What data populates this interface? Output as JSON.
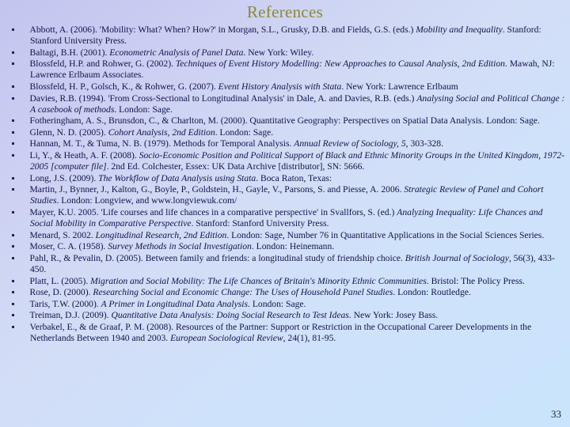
{
  "slide": {
    "title": "References",
    "title_color": "#8a8a2f",
    "text_color": "#12124a",
    "background_start": "#c3c4ef",
    "background_end": "#c9e4fc",
    "page_number": "33"
  },
  "references": [
    {
      "id": "abbott-2006",
      "html": "Abbott, A. (2006). 'Mobility: What? When? How?' in Morgan, S.L., Grusky, D.B. and Fields, G.S. (eds.) <i>Mobility and Inequality</i>. Stanford:  Stanford University Press.",
      "plain": "Abbott, A. (2006). 'Mobility: What? When? How?' in Morgan, S.L., Grusky, D.B. and Fields, G.S. (eds.) Mobility and Inequality. Stanford: Stanford University Press."
    },
    {
      "id": "baltagi-2001",
      "html": "Baltagi, B.H. (2001). <i>Econometric Analysis of Panel Data</i>. New York: Wiley.",
      "plain": "Baltagi, B.H. (2001). Econometric Analysis of Panel Data. New York: Wiley."
    },
    {
      "id": "blossfeld-rohwer-2002",
      "html": "Blossfeld, H.P. and Rohwer, G. (2002). <i>Techniques of Event History Modelling: New Approaches to Causal Analysis, 2nd Edition</i>. Mawah, NJ: Lawrence Erlbaum Associates.",
      "plain": "Blossfeld, H.P. and Rohwer, G. (2002). Techniques of Event History Modelling: New Approaches to Causal Analysis, 2nd Edition. Mawah, NJ: Lawrence Erlbaum Associates."
    },
    {
      "id": "blossfeld-golsch-rohwer-2007",
      "html": "Blossfeld, H. P., Golsch, K., &amp; Rohwer, G. (2007). <i>Event History Analysis with Stata</i>. New York: Lawrence Erlbaum",
      "plain": "Blossfeld, H. P., Golsch, K., & Rohwer, G. (2007). Event History Analysis with Stata. New York: Lawrence Erlbaum"
    },
    {
      "id": "davies-1994",
      "html": "Davies, R.B. (1994). 'From Cross-Sectional to Longitudinal Analysis' in Dale, A. and Davies, R.B. (eds.) <i>Analysing Social and Political  Change : A casebook of methods</i>. London:  Sage.",
      "plain": "Davies, R.B. (1994). 'From Cross-Sectional to Longitudinal Analysis' in Dale, A. and Davies, R.B. (eds.) Analysing Social and Political Change : A casebook of methods. London: Sage."
    },
    {
      "id": "fotheringham-2000",
      "html": "Fotheringham, A. S., Brunsdon, C., &amp; Charlton, M. (2000). Quantitative Geography: Perspectives on Spatial Data Analysis. London: Sage.",
      "plain": "Fotheringham, A. S., Brunsdon, C., & Charlton, M. (2000). Quantitative Geography: Perspectives on Spatial Data Analysis. London: Sage."
    },
    {
      "id": "glenn-2005",
      "html": "Glenn, N. D. (2005). <i>Cohort Analysis, 2nd Edition</i>. London: Sage.",
      "plain": "Glenn, N. D. (2005). Cohort Analysis, 2nd Edition. London: Sage."
    },
    {
      "id": "hannan-tuma-1979",
      "html": "Hannan, M. T., &amp; Tuma, N. B. (1979). Methods for Temporal Analysis. <i>Annual Review of Sociology, 5</i>, 303-328.",
      "plain": "Hannan, M. T., & Tuma, N. B. (1979). Methods for Temporal Analysis. Annual Review of Sociology, 5, 303-328."
    },
    {
      "id": "li-heath-2008",
      "html": "Li, Y., &amp; Heath, A. F. (2008). <i>Socio-Economic Position and Political Support of Black and Ethnic Minority Groups in the United Kingdom, 1972-2005 [computer file]</i>. 2nd Ed. Colchester, Essex: UK Data Archive [distributor], SN: 5666.",
      "plain": "Li, Y., & Heath, A. F. (2008). Socio-Economic Position and Political Support of Black and Ethnic Minority Groups in the United Kingdom, 1972-2005 [computer file]. 2nd Ed. Colchester, Essex: UK Data Archive [distributor], SN: 5666."
    },
    {
      "id": "long-2009",
      "html": "Long, J.S. (2009). <i>The Workflow of Data Analysis using Stata</i>. Boca Raton, Texas:",
      "plain": "Long, J.S. (2009). The Workflow of Data Analysis using Stata. Boca Raton, Texas:"
    },
    {
      "id": "martin-2006",
      "html": "Martin, J., Bynner, J., Kalton, G., Boyle, P., Goldstein, H., Gayle, V., Parsons, S. and Piesse, A. 2006. <i>Strategic Review of Panel and Cohort Studies</i>. London: Longview, and www.longviewuk.com/",
      "plain": "Martin, J., Bynner, J., Kalton, G., Boyle, P., Goldstein, H., Gayle, V., Parsons, S. and Piesse, A. 2006. Strategic Review of Panel and Cohort Studies. London: Longview, and www.longviewuk.com/"
    },
    {
      "id": "mayer-2005",
      "html": "Mayer, K.U. 2005. 'Life courses and life chances in a comparative perspective' in Svallfors, S. (ed.) <i>Analyzing Inequality: Life Chances and Social Mobility in Comparative Perspective</i>. Stanford: Stanford University Press.",
      "plain": "Mayer, K.U. 2005. 'Life courses and life chances in a comparative perspective' in Svallfors, S. (ed.) Analyzing Inequality: Life Chances and Social Mobility in Comparative Perspective. Stanford: Stanford University Press."
    },
    {
      "id": "menard-2002",
      "html": "Menard, S. 2002. <i>Longitudinal Research, 2nd Edition</i>. London: Sage, Number 76 in Quantitative Applications in the Social Sciences Series.",
      "plain": "Menard, S. 2002. Longitudinal Research, 2nd Edition. London: Sage, Number 76 in Quantitative Applications in the Social Sciences Series."
    },
    {
      "id": "moser-1958",
      "html": "Moser, C. A. (1958). <i>Survey Methods in Social Investigation</i>. London: Heinemann.",
      "plain": "Moser, C. A. (1958). Survey Methods in Social Investigation. London: Heinemann."
    },
    {
      "id": "pahl-pevalin-2005",
      "html": "Pahl, R., &amp; Pevalin, D. (2005). Between family and friends: a longitudinal study of friendship choice. <i>British Journal of Sociology</i>, 56(3), 433-450.",
      "plain": "Pahl, R., & Pevalin, D. (2005). Between family and friends: a longitudinal study of friendship choice. British Journal of Sociology, 56(3), 433-450."
    },
    {
      "id": "platt-2005",
      "html": "Platt, L. (2005). <i>Migration and Social Mobility: The Life  Chances of Britain's Minority Ethnic Communities</i>. Bristol: The Policy Press.",
      "plain": "Platt, L. (2005). Migration and Social Mobility: The Life Chances of Britain's Minority Ethnic Communities. Bristol: The Policy Press."
    },
    {
      "id": "rose-2000",
      "html": "Rose, D. (2000). <i>Researching Social and Economic Change: The Uses of Household Panel Studies</i>. London: Routledge.",
      "plain": "Rose, D. (2000). Researching Social and Economic Change: The Uses of Household Panel Studies. London: Routledge."
    },
    {
      "id": "taris-2000",
      "html": "Taris, T.W. (2000). <i>A Primer in Longitudinal Data Analysis</i>. London:  Sage.",
      "plain": "Taris, T.W. (2000). A Primer in Longitudinal Data Analysis. London: Sage."
    },
    {
      "id": "treiman-2009",
      "html": "Treiman, D.J. (2009). <i>Quantitative Data Analysis: Doing Social Research to Test Ideas</i>. New York: Josey Bass.",
      "plain": "Treiman, D.J. (2009). Quantitative Data Analysis: Doing Social Research to Test Ideas. New York: Josey Bass."
    },
    {
      "id": "verbakel-degraaf-2008",
      "html": "Verbakel, E., &amp; de Graaf, P. M. (2008). Resources of the Partner: Support or Restriction in the Occupational Career Developments in the Netherlands Between 1940 and 2003. <i>European Sociological Review</i>, 24(1), 81-95.",
      "plain": "Verbakel, E., & de Graaf, P. M. (2008). Resources of the Partner: Support or Restriction in the Occupational Career Developments in the Netherlands Between 1940 and 2003. European Sociological Review, 24(1), 81-95."
    }
  ]
}
